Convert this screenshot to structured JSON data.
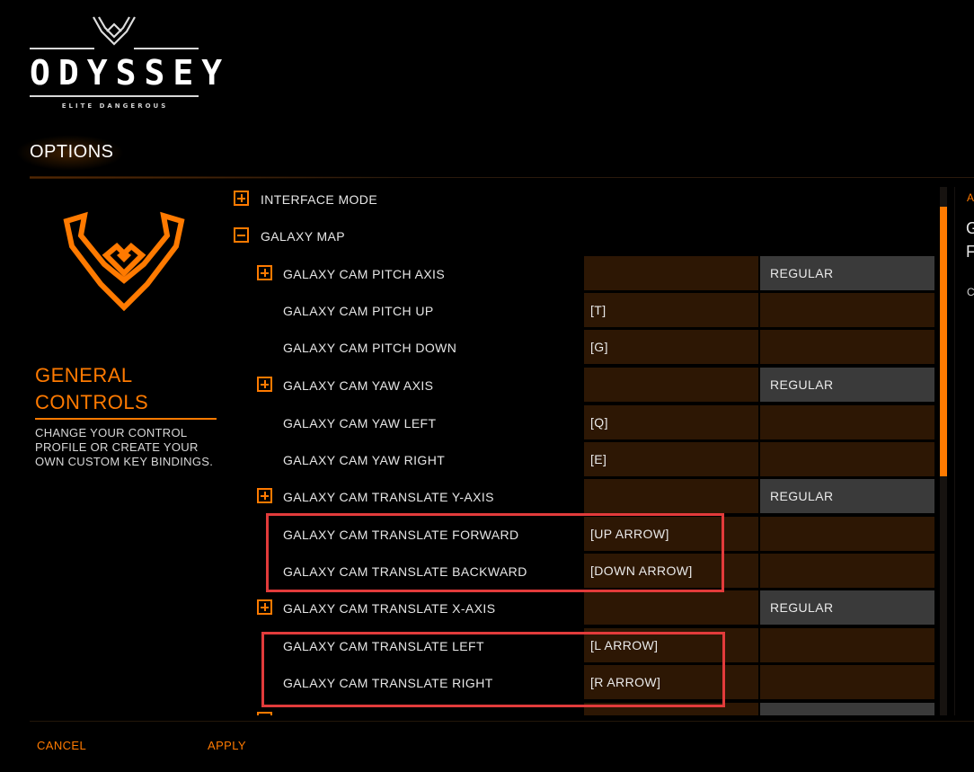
{
  "brand": {
    "wordmark": "ODYSSEY",
    "subtitle": "ELITE DANGEROUS"
  },
  "page": {
    "title": "OPTIONS"
  },
  "left_panel": {
    "title_line1": "GENERAL",
    "title_line2": "CONTROLS",
    "description": "CHANGE YOUR CONTROL PROFILE OR CREATE YOUR OWN CUSTOM KEY BINDINGS."
  },
  "bindings": {
    "interface_mode": {
      "label": "INTERFACE MODE",
      "toggle": "expand"
    },
    "galaxy_map": {
      "label": "GALAXY MAP",
      "toggle": "collapse"
    },
    "pitch_axis": {
      "label": "GALAXY CAM PITCH AXIS",
      "key": "",
      "mode": "REGULAR"
    },
    "pitch_up": {
      "label": "GALAXY CAM PITCH UP",
      "key": "[T]",
      "mode": ""
    },
    "pitch_down": {
      "label": "GALAXY CAM PITCH DOWN",
      "key": "[G]",
      "mode": ""
    },
    "yaw_axis": {
      "label": "GALAXY CAM YAW AXIS",
      "key": "",
      "mode": "REGULAR"
    },
    "yaw_left": {
      "label": "GALAXY CAM YAW LEFT",
      "key": "[Q]",
      "mode": ""
    },
    "yaw_right": {
      "label": "GALAXY CAM YAW RIGHT",
      "key": "[E]",
      "mode": ""
    },
    "translate_y": {
      "label": "GALAXY CAM TRANSLATE Y-AXIS",
      "key": "",
      "mode": "REGULAR"
    },
    "translate_forward": {
      "label": "GALAXY CAM TRANSLATE FORWARD",
      "key": "[UP ARROW]",
      "mode": ""
    },
    "translate_backward": {
      "label": "GALAXY CAM TRANSLATE BACKWARD",
      "key": "[DOWN ARROW]",
      "mode": ""
    },
    "translate_x": {
      "label": "GALAXY CAM TRANSLATE X-AXIS",
      "key": "",
      "mode": "REGULAR"
    },
    "translate_left": {
      "label": "GALAXY CAM TRANSLATE LEFT",
      "key": "[L ARROW]",
      "mode": ""
    },
    "translate_right": {
      "label": "GALAXY CAM TRANSLATE RIGHT",
      "key": "[R ARROW]",
      "mode": ""
    }
  },
  "right_panel": {
    "line_a": "A",
    "line_g1": "G",
    "line_g2": "F",
    "line_c": "C"
  },
  "footer": {
    "cancel_label": "CANCEL",
    "apply_label": "APPLY"
  },
  "colors": {
    "accent": "#ff7a00",
    "binding_cell": "#2d1704",
    "mode_cell_grey": "#3a3a3a",
    "highlight": "#e23b3b",
    "background": "#000000"
  },
  "icons": {
    "logo": "elite-dangerous-wings-icon",
    "emblem": "elite-emblem-icon",
    "expand": "plus-box-icon",
    "collapse": "minus-box-icon"
  }
}
